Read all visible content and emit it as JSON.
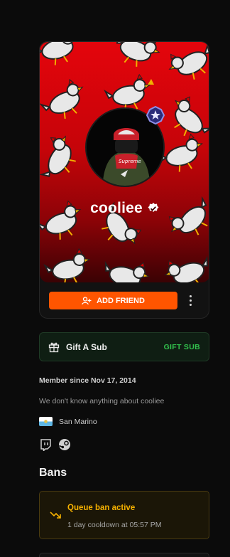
{
  "profile": {
    "username": "cooliee",
    "verified": true,
    "add_friend_label": "ADD FRIEND",
    "avatar_text": "Supreme",
    "accent": "#ff5500",
    "banner_color": "#e4050c"
  },
  "gift": {
    "title": "Gift A Sub",
    "action": "GIFT SUB",
    "accent": "#32c24d"
  },
  "about": {
    "member_since": "Member since Nov 17, 2014",
    "description": "We don't know anything about cooliee",
    "country": "San Marino",
    "socials": [
      "twitch-icon",
      "steam-icon"
    ]
  },
  "bans": {
    "title": "Bans",
    "items": [
      {
        "title": "Queue ban active",
        "subtitle": "1 day cooldown at 05:57 PM",
        "color": "#f5b100"
      }
    ]
  }
}
